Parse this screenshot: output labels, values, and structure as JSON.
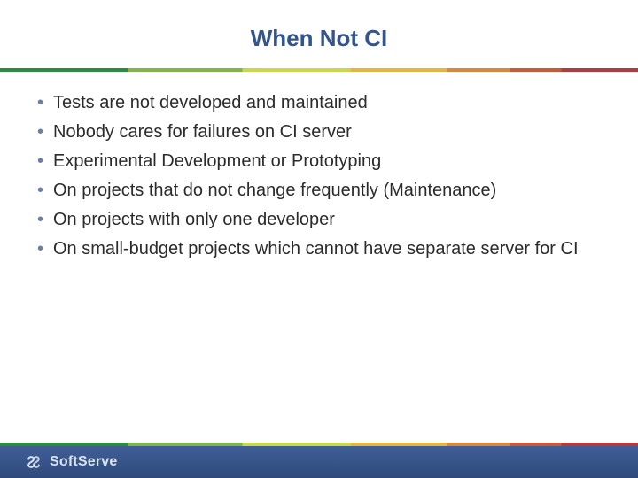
{
  "title": "When Not CI",
  "bullets": [
    "Tests are not developed and maintained",
    "Nobody cares for failures on CI server",
    "Experimental Development or Prototyping",
    "On projects that do not change frequently (Maintenance)",
    "On projects with only one developer",
    "On small-budget projects which cannot have separate server for CI"
  ],
  "brand": "SoftServe",
  "colors": {
    "title": "#33548d",
    "footer_bg": "#2f4a7a"
  }
}
